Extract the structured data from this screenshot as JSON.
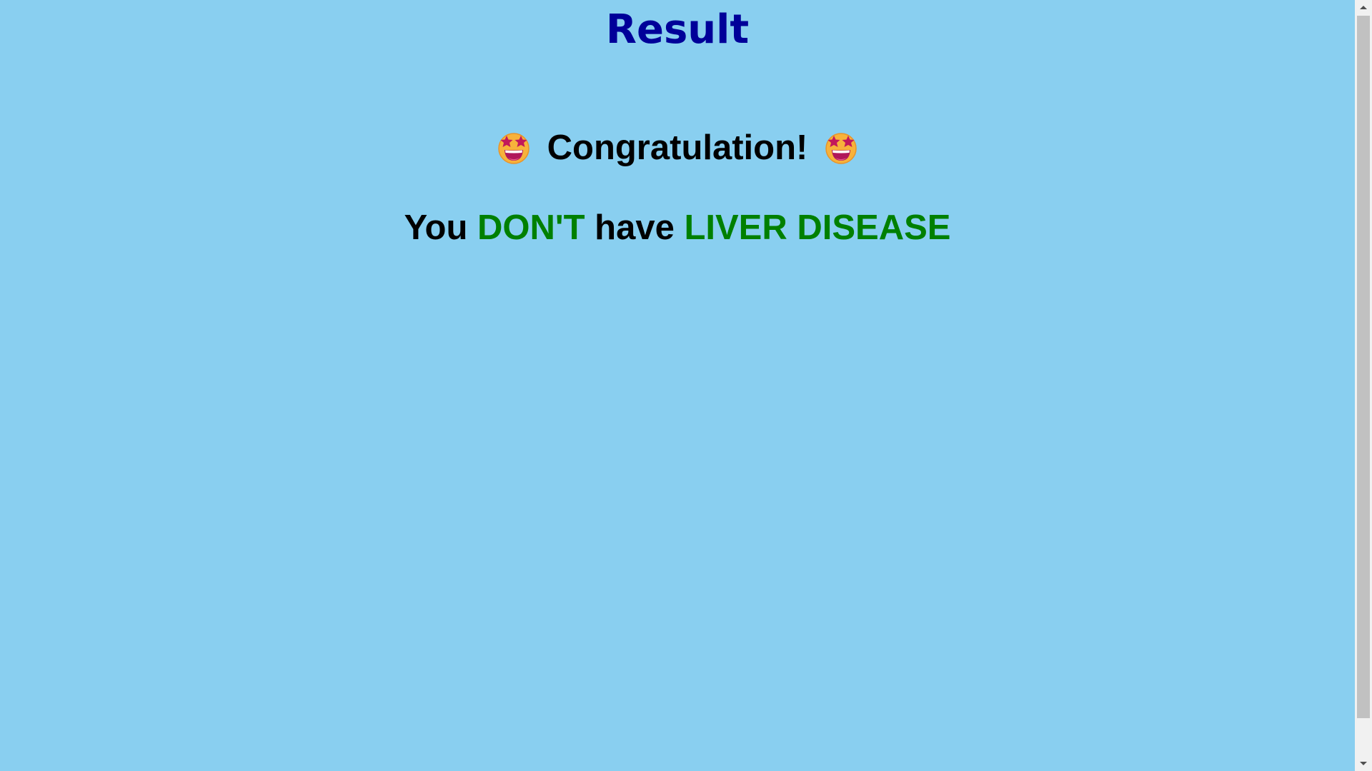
{
  "page": {
    "title": "Result",
    "background_color": "#89CFF0"
  },
  "congrats": {
    "label": "Congratulation!",
    "left_emoji": "star-struck-emoji-icon",
    "right_emoji": "star-struck-emoji-icon"
  },
  "result": {
    "part1": "You ",
    "part2": "DON'T",
    "part3": " have ",
    "part4": "LIVER DISEASE",
    "highlight_color": "#008000"
  },
  "scrollbar": {
    "up_icon": "scroll-up-arrow-icon",
    "down_icon": "scroll-down-arrow-icon"
  }
}
